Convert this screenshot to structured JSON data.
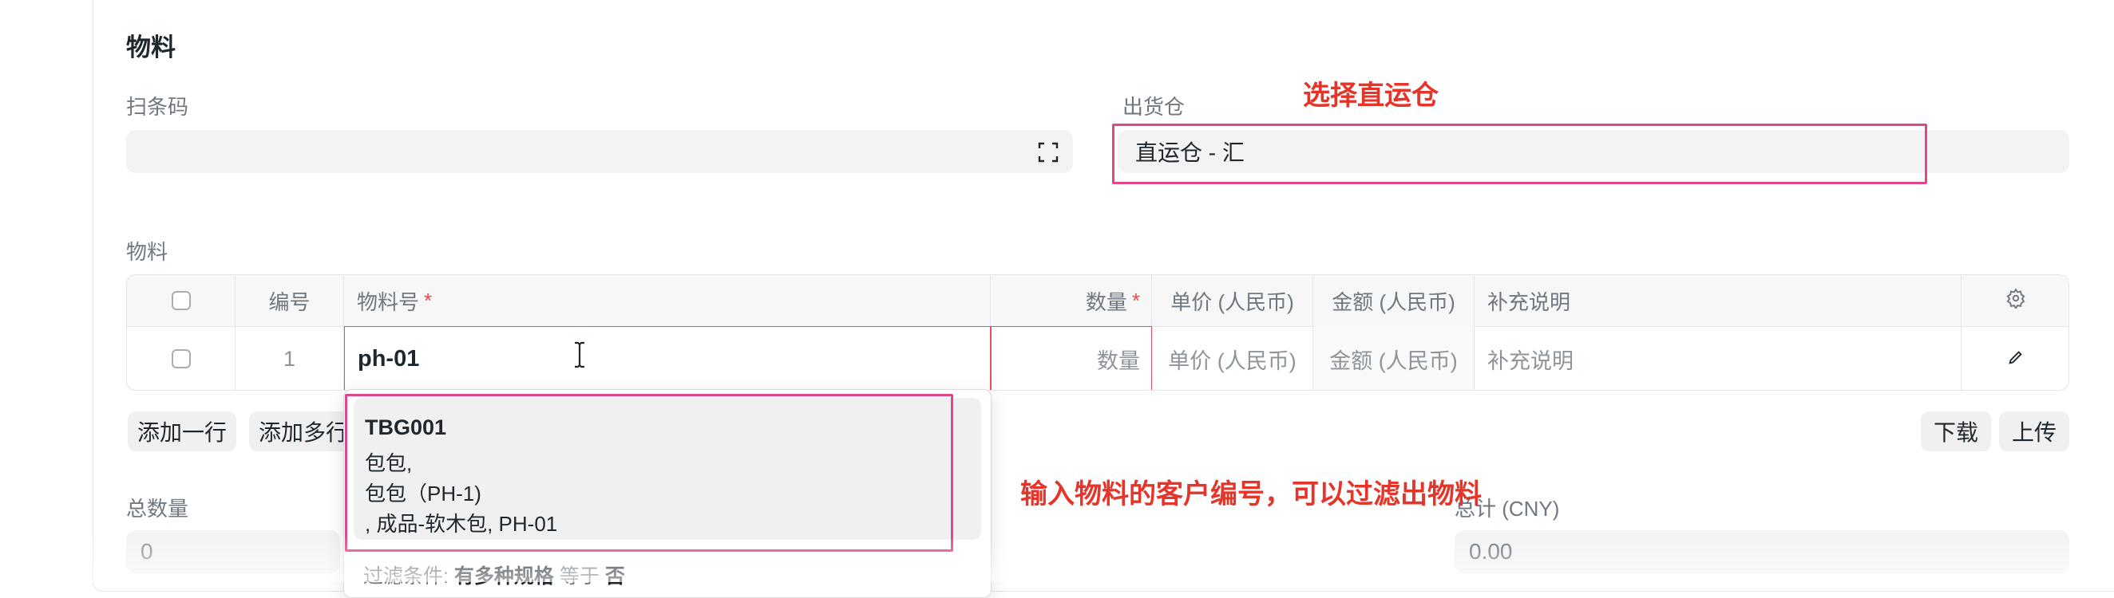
{
  "section": {
    "title": "物料"
  },
  "barcode": {
    "label": "扫条码",
    "value": ""
  },
  "warehouse": {
    "label": "出货仓",
    "value": "直运仓 - 汇"
  },
  "annotations": {
    "warehouse_hint": "选择直运仓",
    "item_hint": "输入物料的客户编号，可以过滤出物料"
  },
  "items_table": {
    "label": "物料",
    "columns": {
      "no": "编号",
      "item_code": "物料号",
      "qty": "数量",
      "rate": "单价 (人民币)",
      "amount": "金额 (人民币)",
      "remarks": "补充说明"
    },
    "required_mark": "*",
    "row": {
      "no": "1",
      "item_code": "ph-01",
      "qty_placeholder": "数量",
      "rate_placeholder": "单价 (人民币)",
      "amount_placeholder": "金额 (人民币)",
      "remarks_placeholder": "补充说明"
    }
  },
  "buttons": {
    "add_row": "添加一行",
    "add_multiple": "添加多行",
    "download": "下载",
    "upload": "上传"
  },
  "totals": {
    "qty_label": "总数量",
    "qty_value": "0",
    "total_label": "总计 (CNY)",
    "total_value": "0.00"
  },
  "dropdown": {
    "item_code": "TBG001",
    "line2": "包包,",
    "line3": "包包（PH-1)",
    "line4": ", 成品-软木包, PH-01",
    "filter_prefix": "过滤条件:",
    "filter_field": "有多种规格",
    "filter_op": "等于",
    "filter_value": "否"
  },
  "colors": {
    "annotation": "#e5352a",
    "highlight": "#e0468b"
  }
}
